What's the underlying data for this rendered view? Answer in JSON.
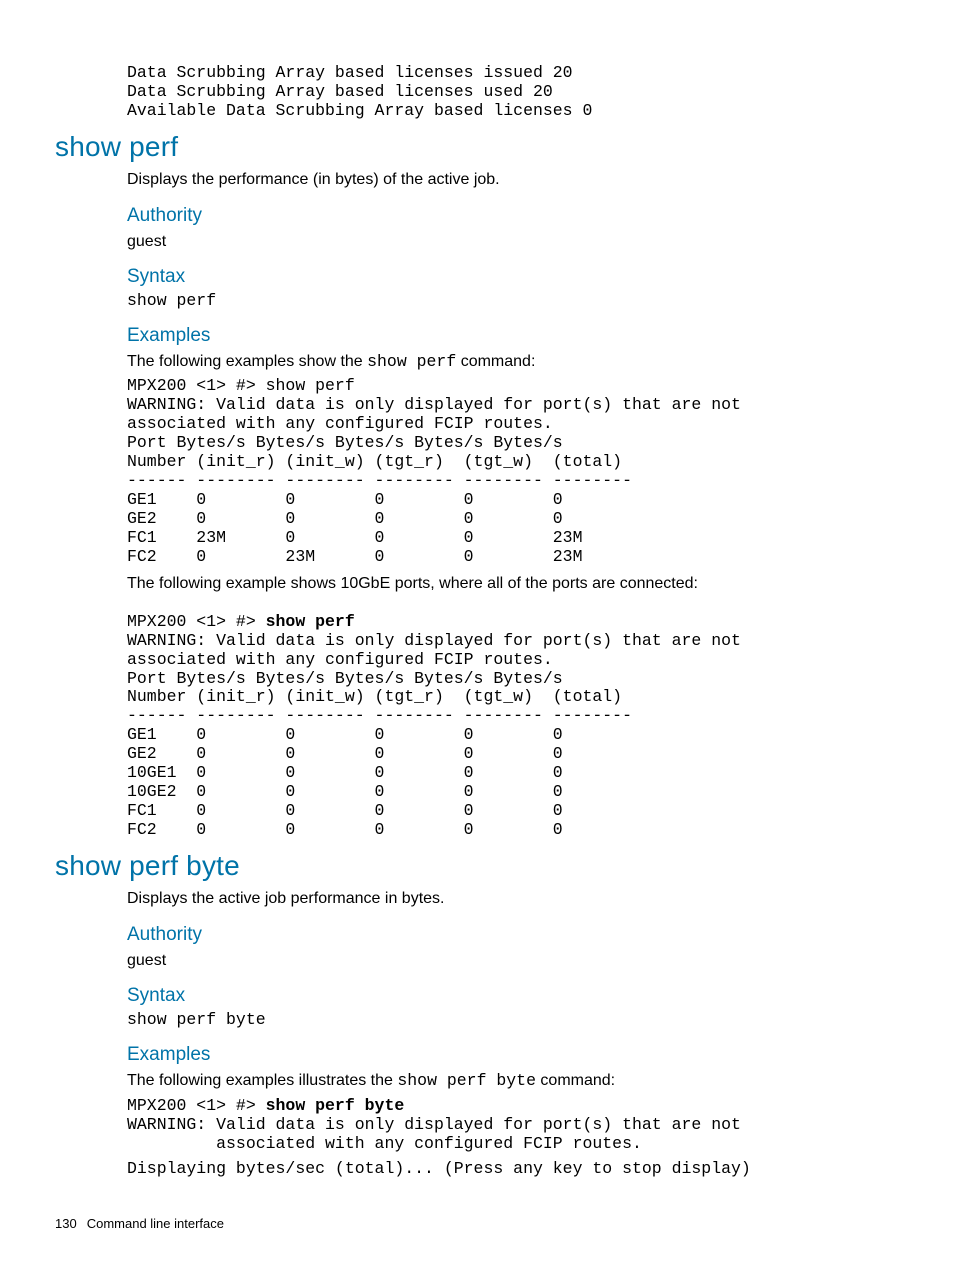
{
  "top_code": "Data Scrubbing Array based licenses issued 20\nData Scrubbing Array based licenses used 20\nAvailable Data Scrubbing Array based licenses 0",
  "section1": {
    "title": "show perf",
    "intro": "Displays the performance (in bytes) of the active job.",
    "authority_h": "Authority",
    "authority_v": "guest",
    "syntax_h": "Syntax",
    "syntax_v": "show perf",
    "examples_h": "Examples",
    "examples_intro_pre": "The following examples show the ",
    "examples_intro_cmd": "show perf",
    "examples_intro_post": " command:",
    "code1": "MPX200 <1> #> show perf\nWARNING: Valid data is only displayed for port(s) that are not\nassociated with any configured FCIP routes.\nPort Bytes/s Bytes/s Bytes/s Bytes/s Bytes/s\nNumber (init_r) (init_w) (tgt_r)  (tgt_w)  (total)\n------ -------- -------- -------- -------- --------\nGE1    0        0        0        0        0\nGE2    0        0        0        0        0\nFC1    23M      0        0        0        23M\nFC2    0        23M      0        0        23M",
    "between": "The following example shows 10GbE ports, where all of the ports are connected:",
    "code2_pre": "MPX200 <1> #> ",
    "code2_cmd": "show perf",
    "code2_rest": "\nWARNING: Valid data is only displayed for port(s) that are not\nassociated with any configured FCIP routes.\nPort Bytes/s Bytes/s Bytes/s Bytes/s Bytes/s\nNumber (init_r) (init_w) (tgt_r)  (tgt_w)  (total)\n------ -------- -------- -------- -------- --------\nGE1    0        0        0        0        0\nGE2    0        0        0        0        0\n10GE1  0        0        0        0        0\n10GE2  0        0        0        0        0\nFC1    0        0        0        0        0\nFC2    0        0        0        0        0"
  },
  "section2": {
    "title": "show perf byte",
    "intro": "Displays the active job performance in bytes.",
    "authority_h": "Authority",
    "authority_v": "guest",
    "syntax_h": "Syntax",
    "syntax_v": "show perf byte",
    "examples_h": "Examples",
    "examples_intro_pre": "The following examples illustrates the ",
    "examples_intro_cmd": "show perf byte",
    "examples_intro_post": " command:",
    "code_pre": "MPX200 <1> #> ",
    "code_cmd": "show perf byte",
    "code_rest": "\nWARNING: Valid data is only displayed for port(s) that are not\n         associated with any configured FCIP routes.",
    "code_last": "Displaying bytes/sec (total)... (Press any key to stop display)"
  },
  "footer": {
    "page": "130",
    "label": "Command line interface"
  }
}
